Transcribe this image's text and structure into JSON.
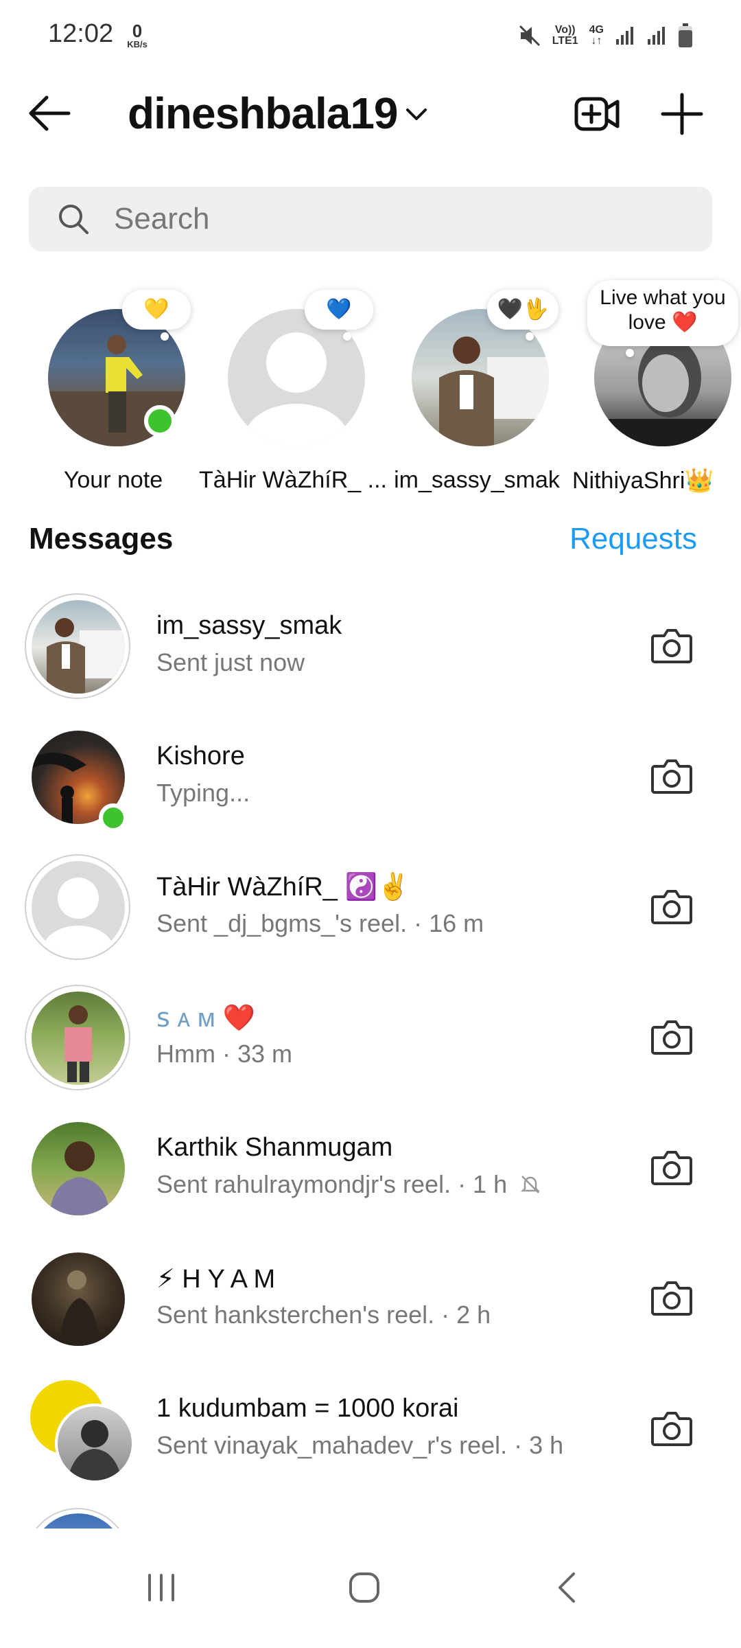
{
  "status_bar": {
    "time": "12:02",
    "net_speed_value": "0",
    "net_speed_unit": "KB/s",
    "volte_label": "Vo))\nLTE1",
    "network_label": "4G"
  },
  "header": {
    "username": "dineshbala19"
  },
  "search": {
    "placeholder": "Search"
  },
  "notes": [
    {
      "name": "Your note",
      "note": "💛",
      "online": true
    },
    {
      "name": "TàHir WàZhíR_ ...",
      "note": "💙",
      "online": false
    },
    {
      "name": "im_sassy_smak",
      "note": "🖤🖖",
      "online": false
    },
    {
      "name": "NithiyaShri👑",
      "note": "Live what you love ❤️",
      "online": false
    }
  ],
  "messages": {
    "title": "Messages",
    "requests_label": "Requests",
    "threads": [
      {
        "name": "im_sassy_smak",
        "preview": "Sent just now"
      },
      {
        "name": "Kishore",
        "preview": "Typing..."
      },
      {
        "name": "TàHir WàZhíR_ ☯️✌️",
        "preview": "Sent _dj_bgms_'s reel. · 16 m"
      },
      {
        "name": "ꜱ ᴀ ᴍ ❤️",
        "preview": "Hmm · 33 m"
      },
      {
        "name": "Karthik Shanmugam",
        "preview": "Sent rahulraymondjr's reel. · 1 h"
      },
      {
        "name": "⚡ H Y A M",
        "preview": "Sent hanksterchen's reel. · 2 h"
      },
      {
        "name": "1 kudumbam = 1000 korai",
        "preview": "Sent vinayak_mahadev_r's reel. · 3 h"
      }
    ]
  },
  "colors": {
    "accent": "#1d9bf0",
    "online": "#3ec22e",
    "secondary_text": "#777777"
  }
}
